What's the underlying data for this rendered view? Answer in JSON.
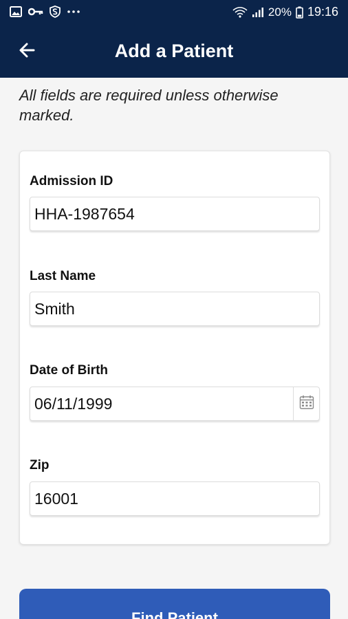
{
  "status_bar": {
    "left_icons": [
      "image-icon",
      "key-icon",
      "shield-s-icon",
      "more-dots-icon"
    ],
    "right_icons": [
      "wifi-icon",
      "signal-icon",
      "battery-icon"
    ],
    "battery": "20%",
    "time": "19:16"
  },
  "app_bar": {
    "back_icon": "arrow-left-icon",
    "title": "Add a Patient"
  },
  "instructions": "All fields are required unless otherwise marked.",
  "form": {
    "admission_id": {
      "label": "Admission ID",
      "value": "HHA-1987654"
    },
    "last_name": {
      "label": "Last Name",
      "value": "Smith"
    },
    "date_of_birth": {
      "label": "Date of Birth",
      "value": "06/11/1999",
      "icon": "calendar-icon"
    },
    "zip": {
      "label": "Zip",
      "value": "16001"
    }
  },
  "actions": {
    "find_patient": "Find Patient"
  },
  "colors": {
    "header": "#0b244a",
    "primary_button": "#2f5cb8",
    "background": "#f5f5f5"
  }
}
